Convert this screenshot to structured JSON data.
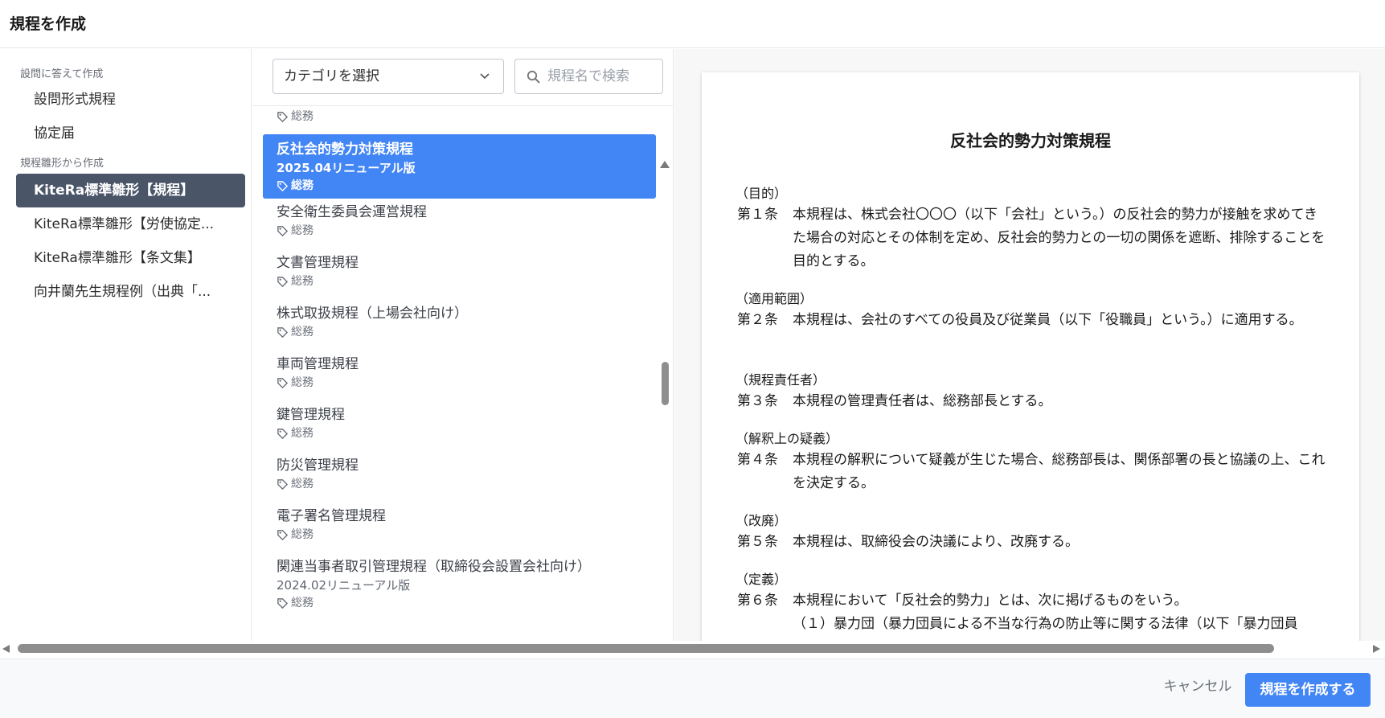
{
  "dialog": {
    "title": "規程を作成"
  },
  "leftnav": {
    "section1_label": "設問に答えて作成",
    "section1_items": [
      "設問形式規程",
      "協定届"
    ],
    "section2_label": "規程雛形から作成",
    "section2_items": [
      "KiteRa標準雛形【規程】",
      "KiteRa標準雛形【労使協定...",
      "KiteRa標準雛形【条文集】",
      "向井蘭先生規程例（出典「..."
    ],
    "active_index": 0
  },
  "toolbar": {
    "category_value": "カテゴリを選択",
    "search_placeholder": "規程名で検索"
  },
  "list": {
    "partial_tag": "総務",
    "items": [
      {
        "name": "反社会的勢力対策規程",
        "sub": "2025.04リニューアル版",
        "tag": "総務",
        "selected": true
      },
      {
        "name": "安全衛生委員会運営規程",
        "tag": "総務"
      },
      {
        "name": "文書管理規程",
        "tag": "総務"
      },
      {
        "name": "株式取扱規程（上場会社向け）",
        "tag": "総務"
      },
      {
        "name": "車両管理規程",
        "tag": "総務"
      },
      {
        "name": "鍵管理規程",
        "tag": "総務"
      },
      {
        "name": "防災管理規程",
        "tag": "総務"
      },
      {
        "name": "電子署名管理規程",
        "tag": "総務"
      },
      {
        "name": "関連当事者取引管理規程（取締役会設置会社向け）",
        "sub": "2024.02リニューアル版",
        "tag": "総務"
      }
    ]
  },
  "preview": {
    "title": "反社会的勢力対策規程",
    "articles": [
      {
        "heading": "（目的）",
        "num": "第１条",
        "text": "本規程は、株式会社〇〇〇（以下「会社」という。）の反社会的勢力が接触を求めてきた場合の対応とその体制を定め、反社会的勢力との一切の関係を遮断、排除することを目的とする。"
      },
      {
        "heading": "（適用範囲）",
        "num": "第２条",
        "text": "本規程は、会社のすべての役員及び従業員（以下「役職員」という。）に適用する。"
      },
      {
        "heading": "（規程責任者）",
        "num": "第３条",
        "text": "本規程の管理責任者は、総務部長とする。"
      },
      {
        "heading": "（解釈上の疑義）",
        "num": "第４条",
        "text": "本規程の解釈について疑義が生じた場合、総務部長は、関係部署の長と協議の上、これを決定する。"
      },
      {
        "heading": "（改廃）",
        "num": "第５条",
        "text": "本規程は、取締役会の決議により、改廃する。"
      },
      {
        "heading": "（定義）",
        "num": "第６条",
        "text": "本規程において「反社会的勢力」とは、次に掲げるものをいう。",
        "sub": "（１）暴力団（暴力団員による不当な行為の防止等に関する法律（以下「暴力団員"
      }
    ]
  },
  "footer": {
    "cancel_label": "キャンセル",
    "create_label": "規程を作成する"
  },
  "colors": {
    "accent": "#4285f4",
    "nav_active": "#4a5568"
  },
  "icons": [
    "chevron-down-icon",
    "search-icon",
    "tag-icon",
    "scroll-up-icon",
    "scroll-down-icon",
    "scroll-left-icon",
    "scroll-right-icon"
  ]
}
